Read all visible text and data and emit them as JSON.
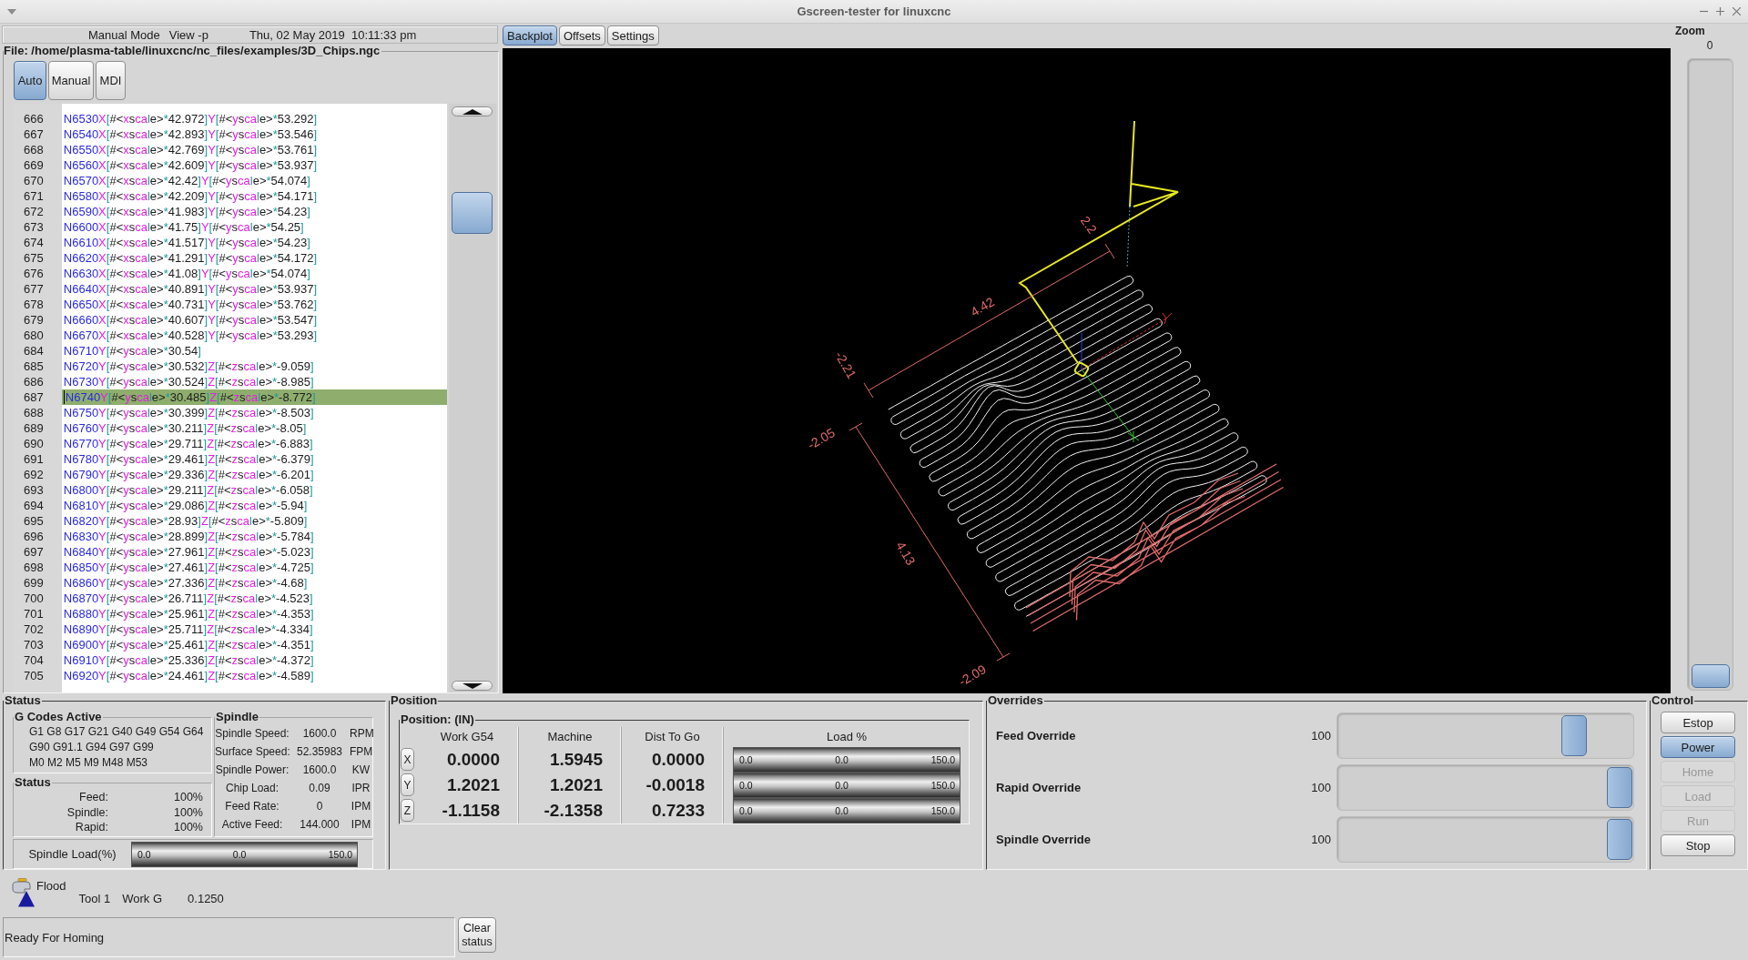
{
  "window": {
    "title": "Gscreen-tester for linuxcnc"
  },
  "header": {
    "mode": "Manual Mode",
    "view": "View -p",
    "datetime": "Thu, 02 May 2019  10:11:33 pm"
  },
  "file_label": "File: /home/plasma-table/linuxcnc/nc_files/examples/3D_Chips.ngc",
  "mode_buttons": [
    {
      "label": "Auto",
      "selected": true
    },
    {
      "label": "Manual",
      "selected": false
    },
    {
      "label": "MDI",
      "selected": false
    }
  ],
  "gcode": {
    "lines": [
      {
        "number": "666",
        "code": "N6530X[#<xscale>*42.972]Y[#<yscale>*53.292]",
        "selected": false
      },
      {
        "number": "667",
        "code": "N6540X[#<xscale>*42.893]Y[#<yscale>*53.546]",
        "selected": false
      },
      {
        "number": "668",
        "code": "N6550X[#<xscale>*42.769]Y[#<yscale>*53.761]",
        "selected": false
      },
      {
        "number": "669",
        "code": "N6560X[#<xscale>*42.609]Y[#<yscale>*53.937]",
        "selected": false
      },
      {
        "number": "670",
        "code": "N6570X[#<xscale>*42.42]Y[#<yscale>*54.074]",
        "selected": false
      },
      {
        "number": "671",
        "code": "N6580X[#<xscale>*42.209]Y[#<yscale>*54.171]",
        "selected": false
      },
      {
        "number": "672",
        "code": "N6590X[#<xscale>*41.983]Y[#<yscale>*54.23]",
        "selected": false
      },
      {
        "number": "673",
        "code": "N6600X[#<xscale>*41.75]Y[#<yscale>*54.25]",
        "selected": false
      },
      {
        "number": "674",
        "code": "N6610X[#<xscale>*41.517]Y[#<yscale>*54.23]",
        "selected": false
      },
      {
        "number": "675",
        "code": "N6620X[#<xscale>*41.291]Y[#<yscale>*54.172]",
        "selected": false
      },
      {
        "number": "676",
        "code": "N6630X[#<xscale>*41.08]Y[#<yscale>*54.074]",
        "selected": false
      },
      {
        "number": "677",
        "code": "N6640X[#<xscale>*40.891]Y[#<yscale>*53.937]",
        "selected": false
      },
      {
        "number": "678",
        "code": "N6650X[#<xscale>*40.731]Y[#<yscale>*53.762]",
        "selected": false
      },
      {
        "number": "679",
        "code": "N6660X[#<xscale>*40.607]Y[#<yscale>*53.547]",
        "selected": false
      },
      {
        "number": "680",
        "code": "N6670X[#<xscale>*40.528]Y[#<yscale>*53.293]",
        "selected": false
      },
      {
        "number": "684",
        "code": "N6710Y[#<yscale>*30.54]",
        "selected": false
      },
      {
        "number": "685",
        "code": "N6720Y[#<yscale>*30.532]Z[#<zscale>*-9.059]",
        "selected": false
      },
      {
        "number": "686",
        "code": "N6730Y[#<yscale>*30.524]Z[#<zscale>*-8.985]",
        "selected": false
      },
      {
        "number": "687",
        "code": "N6740Y[#<yscale>*30.485]Z[#<zscale>*-8.772]",
        "selected": true
      },
      {
        "number": "688",
        "code": "N6750Y[#<yscale>*30.399]Z[#<zscale>*-8.503]",
        "selected": false
      },
      {
        "number": "689",
        "code": "N6760Y[#<yscale>*30.211]Z[#<zscale>*-8.05]",
        "selected": false
      },
      {
        "number": "690",
        "code": "N6770Y[#<yscale>*29.711]Z[#<zscale>*-6.883]",
        "selected": false
      },
      {
        "number": "691",
        "code": "N6780Y[#<yscale>*29.461]Z[#<zscale>*-6.379]",
        "selected": false
      },
      {
        "number": "692",
        "code": "N6790Y[#<yscale>*29.336]Z[#<zscale>*-6.201]",
        "selected": false
      },
      {
        "number": "693",
        "code": "N6800Y[#<yscale>*29.211]Z[#<zscale>*-6.058]",
        "selected": false
      },
      {
        "number": "694",
        "code": "N6810Y[#<yscale>*29.086]Z[#<zscale>*-5.94]",
        "selected": false
      },
      {
        "number": "695",
        "code": "N6820Y[#<yscale>*28.93]Z[#<zscale>*-5.809]",
        "selected": false
      },
      {
        "number": "696",
        "code": "N6830Y[#<yscale>*28.899]Z[#<zscale>*-5.784]",
        "selected": false
      },
      {
        "number": "697",
        "code": "N6840Y[#<yscale>*27.961]Z[#<zscale>*-5.023]",
        "selected": false
      },
      {
        "number": "698",
        "code": "N6850Y[#<yscale>*27.461]Z[#<zscale>*-4.725]",
        "selected": false
      },
      {
        "number": "699",
        "code": "N6860Y[#<yscale>*27.336]Z[#<zscale>*-4.68]",
        "selected": false
      },
      {
        "number": "700",
        "code": "N6870Y[#<yscale>*26.711]Z[#<zscale>*-4.523]",
        "selected": false
      },
      {
        "number": "701",
        "code": "N6880Y[#<yscale>*25.961]Z[#<zscale>*-4.353]",
        "selected": false
      },
      {
        "number": "702",
        "code": "N6890Y[#<yscale>*25.711]Z[#<zscale>*-4.334]",
        "selected": false
      },
      {
        "number": "703",
        "code": "N6900Y[#<yscale>*25.461]Z[#<zscale>*-4.351]",
        "selected": false
      },
      {
        "number": "704",
        "code": "N6910Y[#<yscale>*25.336]Z[#<zscale>*-4.372]",
        "selected": false
      },
      {
        "number": "705",
        "code": "N6920Y[#<yscale>*24.461]Z[#<zscale>*-4.589]",
        "selected": false
      }
    ]
  },
  "view_tabs": [
    {
      "label": "Backplot",
      "selected": true
    },
    {
      "label": "Offsets",
      "selected": false
    },
    {
      "label": "Settings",
      "selected": false
    }
  ],
  "backplot": {
    "dimension_labels": [
      "2.2",
      "4.42",
      "-2.21",
      "-2.05",
      "4.13",
      "-2.09"
    ]
  },
  "zoom": {
    "label": "Zoom",
    "reading": "0",
    "level": 0
  },
  "status_panel": {
    "title": "Status",
    "gcodes": {
      "title": "G Codes Active",
      "lines": [
        "G1 G8 G17 G21 G40 G49 G54 G64",
        "G90 G91.1 G94 G97 G99",
        "M0 M2 M5 M9 M48 M53"
      ]
    },
    "status": {
      "title": "Status",
      "rows": [
        {
          "label": "Feed:",
          "value": "100%"
        },
        {
          "label": "Spindle:",
          "value": "100%"
        },
        {
          "label": "Rapid:",
          "value": "100%"
        }
      ]
    },
    "spindle": {
      "title": "Spindle",
      "rows": [
        {
          "label": "Spindle Speed:",
          "value": "1600.0",
          "unit": "RPM"
        },
        {
          "label": "Surface Speed:",
          "value": "52.35983",
          "unit": "FPM"
        },
        {
          "label": "Spindle Power:",
          "value": "1600.0",
          "unit": "KW"
        },
        {
          "label": "Chip Load:",
          "value": "0.09",
          "unit": "IPR"
        },
        {
          "label": "Feed Rate:",
          "value": "0",
          "unit": "IPM"
        },
        {
          "label": "Active Feed:",
          "value": "144.000",
          "unit": "IPM"
        }
      ]
    },
    "spindle_load": {
      "label": "Spindle Load(%)",
      "min": "0.0",
      "value": "0.0",
      "max": "150.0",
      "level": 0
    }
  },
  "position": {
    "title": "Position",
    "subtitle": "Position: (IN)",
    "columns": [
      "Work G54",
      "Machine",
      "Dist To Go"
    ],
    "load_title": "Load %",
    "axes": [
      {
        "axis": "X",
        "work": "0.0000",
        "machine": "1.5945",
        "dist_to_go": "0.0000",
        "load": {
          "min": "0.0",
          "value": "0.0",
          "max": "150.0",
          "level": 0
        }
      },
      {
        "axis": "Y",
        "work": "1.2021",
        "machine": "1.2021",
        "dist_to_go": "-0.0018",
        "load": {
          "min": "0.0",
          "value": "0.0",
          "max": "150.0",
          "level": 0
        }
      },
      {
        "axis": "Z",
        "work": "-1.1158",
        "machine": "-2.1358",
        "dist_to_go": "0.7233",
        "load": {
          "min": "0.0",
          "value": "0.0",
          "max": "150.0",
          "level": 0
        }
      }
    ]
  },
  "overrides": {
    "title": "Overrides",
    "items": [
      {
        "label": "Feed Override",
        "value": "100",
        "level": 0.83
      },
      {
        "label": "Rapid Override",
        "value": "100",
        "level": 1
      },
      {
        "label": "Spindle Override",
        "value": "100",
        "level": 1
      }
    ]
  },
  "control": {
    "title": "Control",
    "buttons": [
      {
        "label": "Estop",
        "active": false,
        "disabled": false
      },
      {
        "label": "Power",
        "active": true,
        "disabled": false
      },
      {
        "label": "Home",
        "active": false,
        "disabled": true
      },
      {
        "label": "Load",
        "active": false,
        "disabled": true
      },
      {
        "label": "Run",
        "active": false,
        "disabled": true
      },
      {
        "label": "Stop",
        "active": false,
        "disabled": false
      }
    ]
  },
  "tool_info": {
    "coolant": "Flood",
    "tool": "Tool 1",
    "work": "Work G",
    "value": "0.1250"
  },
  "status_bar": {
    "message": "Ready For Homing",
    "button": "Clear status"
  }
}
